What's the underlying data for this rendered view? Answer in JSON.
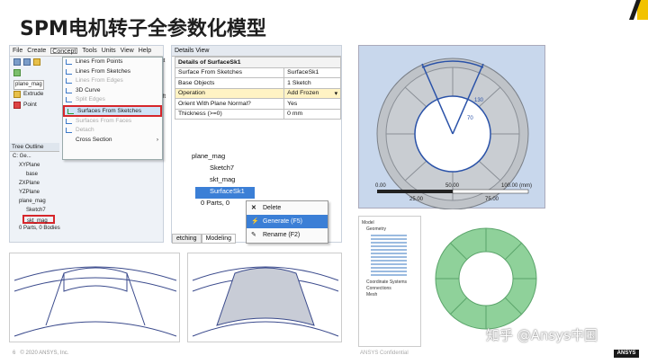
{
  "title": "SPM电机转子全参数化模型",
  "menubar": [
    "File",
    "Create",
    "Concept",
    "Tools",
    "Units",
    "View",
    "Help"
  ],
  "toolbar": {
    "plane_field": "plane_mag",
    "extrude": "Extrude",
    "point": "Point"
  },
  "concept_menu": [
    {
      "label": "Lines From Points",
      "state": "normal"
    },
    {
      "label": "Lines From Sketches",
      "state": "normal"
    },
    {
      "label": "Lines From Edges",
      "state": "disabled"
    },
    {
      "label": "3D Curve",
      "state": "normal"
    },
    {
      "label": "Split Edges",
      "state": "disabled"
    },
    {
      "label": "Surfaces From Sketches",
      "state": "highlighted"
    },
    {
      "label": "Surfaces From Faces",
      "state": "disabled"
    },
    {
      "label": "Detach",
      "state": "disabled"
    },
    {
      "label": "Cross Section",
      "state": "normal"
    }
  ],
  "tree_outline": {
    "header": "Tree Outline",
    "items": [
      "C: Ge...",
      "XYPlane",
      "base",
      "ZXPlane",
      "YZPlane",
      "plane_mag",
      "Sketch7",
      "skt_mag",
      "0 Parts, 0 Bodies"
    ]
  },
  "side_labels": {
    "lect": "lect",
    "loft": "Loft",
    "ics": "ics"
  },
  "details_view": {
    "header": "Details View",
    "section": "Details of SurfaceSk1",
    "rows": [
      {
        "key": "Surface From Sketches",
        "value": "SurfaceSk1"
      },
      {
        "key": "Base Objects",
        "value": "1 Sketch"
      },
      {
        "key": "Operation",
        "value": "Add Frozen"
      },
      {
        "key": "Orient With Plane Normal?",
        "value": "Yes"
      },
      {
        "key": "Thickness (>=0)",
        "value": "0 mm"
      }
    ]
  },
  "tree2": [
    "plane_mag",
    "Sketch7",
    "skt_mag",
    "SurfaceSk1",
    "0 Parts, 0"
  ],
  "context_menu": [
    {
      "label": "Delete",
      "icon": "close-icon"
    },
    {
      "label": "Generate (F5)",
      "icon": "lightning-icon"
    },
    {
      "label": "Rename (F2)",
      "icon": "rename-icon"
    }
  ],
  "bottom_tabs": [
    "etching",
    "Modeling"
  ],
  "scale_bar": {
    "labels_top": [
      "0.00",
      "50.00",
      "100.00 (mm)"
    ],
    "labels_bottom": [
      "25.00",
      "75.00"
    ]
  },
  "dims": {
    "d1": "130",
    "d2": "70"
  },
  "mini_tree": [
    "Model",
    "Geometry",
    "Coordinate Systems",
    "Connections",
    "Mesh"
  ],
  "footer": {
    "page": "6",
    "copyright": "© 2020 ANSYS, Inc.",
    "brand": "ANSYS",
    "confidential": "ANSYS Confidential"
  },
  "watermark": "知乎 @Ansys中国",
  "colors": {
    "accent_red": "#d6262b",
    "selection_blue": "#3b7fd6",
    "model_green": "#8fd19a",
    "corner_yellow": "#f2c200"
  }
}
